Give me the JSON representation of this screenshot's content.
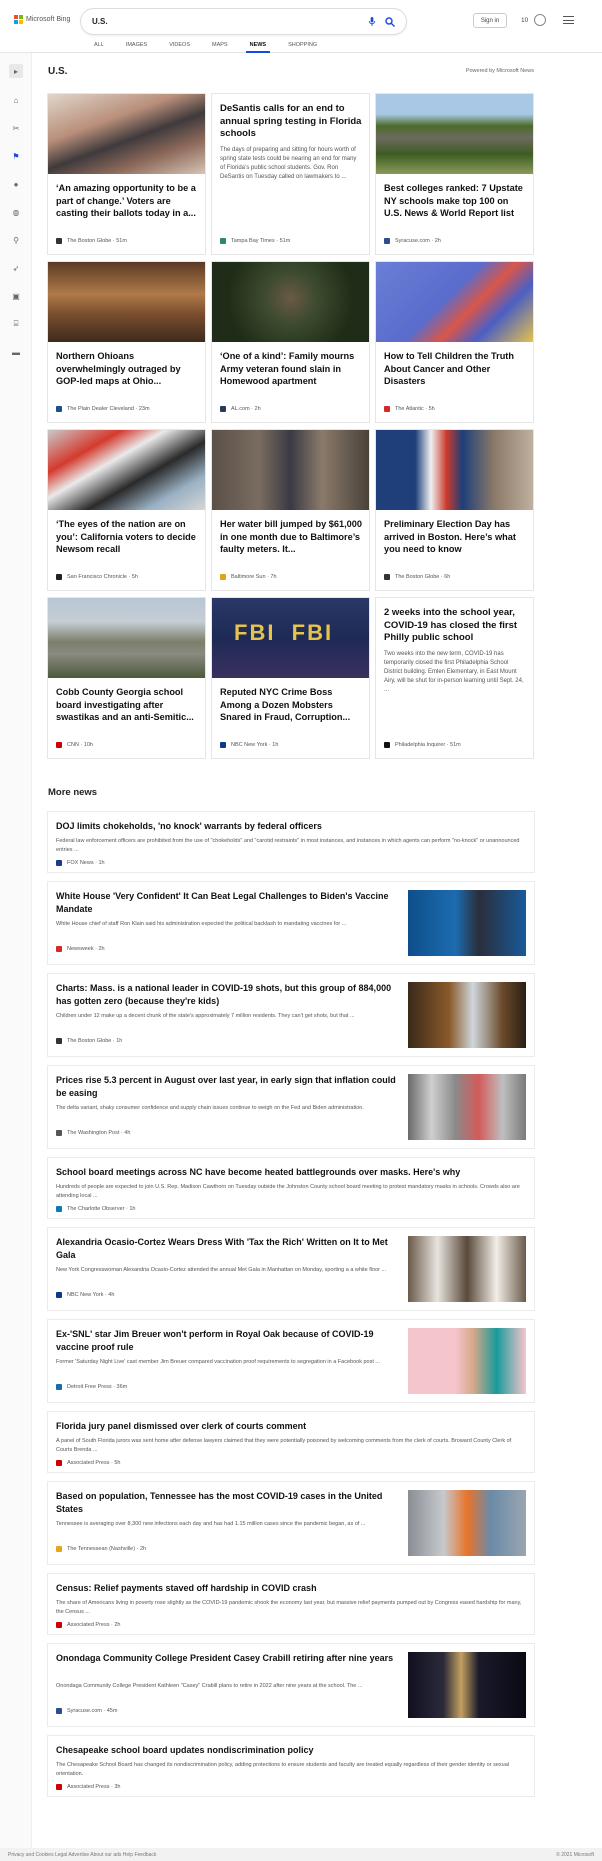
{
  "header": {
    "logo_text": "Microsoft Bing",
    "query": "U.S.",
    "sign_in": "Sign in",
    "rewards_count": "10",
    "colors": {
      "accent": "#174ae4"
    }
  },
  "tabs": [
    {
      "label": "ALL"
    },
    {
      "label": "IMAGES"
    },
    {
      "label": "VIDEOS"
    },
    {
      "label": "MAPS"
    },
    {
      "label": "NEWS"
    },
    {
      "label": "SHOPPING"
    }
  ],
  "rail": {
    "icons": [
      "arrow-right-icon",
      "home-icon",
      "tools-icon",
      "flag-icon",
      "location-pin-icon",
      "globe-icon",
      "microscope-icon",
      "rocket-icon",
      "film-icon",
      "bank-icon",
      "money-icon"
    ]
  },
  "page": {
    "title": "U.S.",
    "powered_by": "Powered by Microsoft News",
    "more_news": "More news"
  },
  "cards": [
    {
      "title": "‘An amazing opportunity to be a part of change.’ Voters are casting their ballots today in a...",
      "source": "The Boston Globe · 51m",
      "desc": ""
    },
    {
      "title": "DeSantis calls for an end to annual spring testing in Florida schools",
      "source": "Tampa Bay Times · 51m",
      "desc": "The days of preparing and sitting for hours worth of spring state tests could be nearing an end for many of Florida’s public school students. Gov. Ron DeSantis on Tuesday called on lawmakers to ..."
    },
    {
      "title": "Best colleges ranked: 7 Upstate NY schools make top 100 on U.S. News & World Report list",
      "source": "Syracuse.com · 2h",
      "desc": ""
    },
    {
      "title": "Northern Ohioans overwhelmingly outraged by GOP-led maps at Ohio...",
      "source": "The Plain Dealer Cleveland · 23m",
      "desc": ""
    },
    {
      "title": "‘One of a kind’: Family mourns Army veteran found slain in Homewood apartment",
      "source": "AL.com · 2h",
      "desc": ""
    },
    {
      "title": "How to Tell Children the Truth About Cancer and Other Disasters",
      "source": "The Atlantic · 5h",
      "desc": ""
    },
    {
      "title": "‘The eyes of the nation are on you’: California voters to decide Newsom recall",
      "source": "San Francisco Chronicle · 5h",
      "desc": ""
    },
    {
      "title": "Her water bill jumped by $61,000 in one month due to Baltimore’s faulty meters. It...",
      "source": "Baltimore Sun · 7h",
      "desc": ""
    },
    {
      "title": "Preliminary Election Day has arrived in Boston. Here’s what you need to know",
      "source": "The Boston Globe · 6h",
      "desc": ""
    },
    {
      "title": "Cobb County Georgia school board investigating after swastikas and an anti-Semitic...",
      "source": "CNN · 10h",
      "desc": ""
    },
    {
      "title": "Reputed NYC Crime Boss Among a Dozen Mobsters Snared in Fraud, Corruption...",
      "source": "NBC New York · 1h",
      "desc": ""
    },
    {
      "title": "2 weeks into the school year, COVID-19 has closed the first Philly public school",
      "source": "Philadelphia Inquirer · 51m",
      "desc": "Two weeks into the new term, COVID-19 has temporarily closed the first Philadelphia School District building. Emlen Elementary, in East Mount Airy, will be shut for in-person learning until Sept. 24, ..."
    }
  ],
  "more": [
    {
      "title": "DOJ limits chokeholds, 'no knock' warrants by federal officers",
      "desc": "Federal law enforcement officers are prohibited from the use of \"chokeholds\" and \"carotid restraints\" in most instances, and instances in which agents can perform \"no-knock\" or unannounced entries ...",
      "source": "FOX News · 1h"
    },
    {
      "title": "White House 'Very Confident' It Can Beat Legal Challenges to Biden's Vaccine Mandate",
      "desc": "White House chief of staff Ron Klain said his administration expected the political backlash to mandating vaccines for ...",
      "source": "Newsweek · 2h"
    },
    {
      "title": "Charts: Mass. is a national leader in COVID-19 shots, but this group of 884,000 has gotten zero (because they're kids)",
      "desc": "Children under 12 make up a decent chunk of the state's approximately 7 million residents. They can't get shots, but that ...",
      "source": "The Boston Globe · 1h"
    },
    {
      "title": "Prices rise 5.3 percent in August over last year, in early sign that inflation could be easing",
      "desc": "The delta variant, shaky consumer confidence and supply chain issues continue to weigh on the Fed and Biden administration.",
      "source": "The Washington Post · 4h"
    },
    {
      "title": "School board meetings across NC have become heated battlegrounds over masks. Here's why",
      "desc": "Hundreds of people are expected to join U.S. Rep. Madison Cawthorn on Tuesday outside the Johnston County school board meeting to protest mandatory masks in schools. Crowds also are attending local ...",
      "source": "The Charlotte Observer · 1h"
    },
    {
      "title": "Alexandria Ocasio-Cortez Wears Dress With 'Tax the Rich' Written on It to Met Gala",
      "desc": "New York Congresswoman Alexandria Ocasio-Cortez attended the annual Met Gala in Manhattan on Monday, sporting a a white floor ...",
      "source": "NBC New York · 4h"
    },
    {
      "title": "Ex-'SNL' star Jim Breuer won't perform in Royal Oak because of COVID-19 vaccine proof rule",
      "desc": "Former 'Saturday Night Live' cast member Jim Breuer compared vaccination proof requirements to segregation in a Facebook post ...",
      "source": "Detroit Free Press · 36m"
    },
    {
      "title": "Florida jury panel dismissed over clerk of courts comment",
      "desc": "A panel of South Florida jurors was sent home after defense lawyers claimed that they were potentially poisoned by welcoming comments from the clerk of courts. Broward County Clerk of Courts Brenda ...",
      "source": "Associated Press · 5h"
    },
    {
      "title": "Based on population, Tennessee has the most COVID-19 cases in the United States",
      "desc": "Tennessee is averaging over 8,300 new infections each day and has had 1.15 million cases since the pandemic began, as of ...",
      "source": "The Tennessean (Nashville) · 2h"
    },
    {
      "title": "Census: Relief payments staved off hardship in COVID crash",
      "desc": "The share of Americans living in poverty rose slightly as the COVID-19 pandemic shook the economy last year, but massive relief payments pumped out by Congress eased hardship for many, the Census ...",
      "source": "Associated Press · 2h"
    },
    {
      "title": "Onondaga Community College President Casey Crabill retiring after nine years",
      "desc": "Onondaga Community College President Kathleen \"Casey\" Crabill plans to retire in 2022 after nine years at the school. The ...",
      "source": "Syracuse.com · 45m"
    },
    {
      "title": "Chesapeake school board updates nondiscrimination policy",
      "desc": "The Chesapeake School Board has changed its nondiscrimination policy, adding protections to ensure students and faculty are treated equally regardless of their gender identity or sexual orientation.",
      "source": "Associated Press · 3h"
    }
  ],
  "footer": {
    "left": "Privacy and Cookies   Legal   Advertise   About our ads   Help   Feedback",
    "right": "© 2021 Microsoft"
  }
}
